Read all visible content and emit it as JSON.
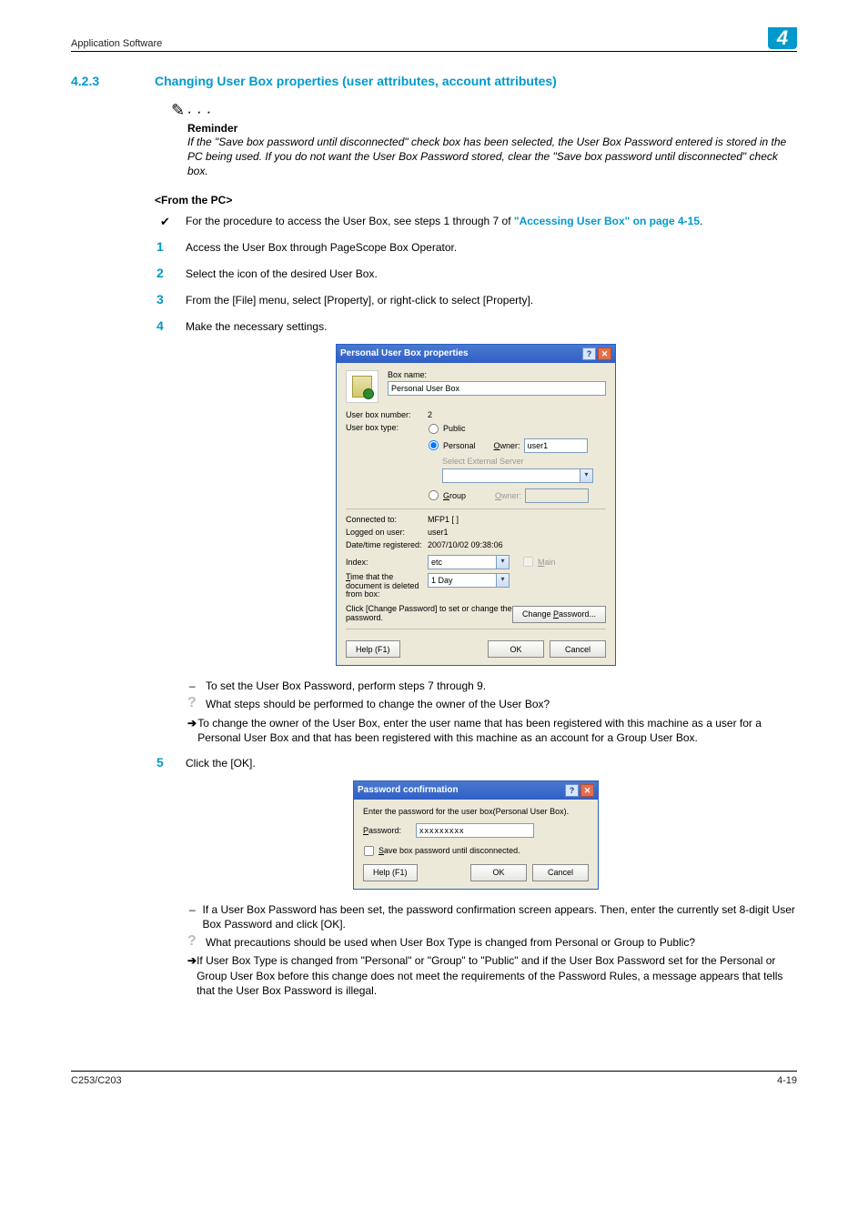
{
  "header": {
    "running_head": "Application Software",
    "chapter_badge": "4"
  },
  "section": {
    "number": "4.2.3",
    "title": "Changing User Box properties (user attributes, account attributes)"
  },
  "reminder": {
    "label": "Reminder",
    "body": "If the \"Save box password until disconnected\" check box has been selected, the User Box Password entered is stored in the PC being used. If you do not want the User Box Password stored, clear the \"Save box password until disconnected\" check box."
  },
  "fromPC": {
    "heading": "<From the PC>",
    "check_prefix": "For the procedure to access the User Box, see steps 1 through 7 of ",
    "check_link": "\"Accessing User Box\" on page 4-15",
    "check_suffix": "."
  },
  "steps": {
    "s1": "Access the User Box through PageScope Box Operator.",
    "s2": "Select the icon of the desired User Box.",
    "s3": "From the [File] menu, select [Property], or right-click to select [Property].",
    "s4": "Make the necessary settings.",
    "s5": "Click the [OK]."
  },
  "dialog1": {
    "title": "Personal User Box properties",
    "boxname_label": "Box name:",
    "boxname_value": "Personal User Box",
    "num_label": "User box number:",
    "num_value": "2",
    "type_label": "User box type:",
    "type_public": "Public",
    "type_personal": "Personal",
    "owner_label": "Owner:",
    "owner_value": "user1",
    "ext_label": "Select External Server",
    "type_group": "Group",
    "group_owner_label": "Owner:",
    "connected_label": "Connected to:",
    "connected_value": "MFP1 [                ]",
    "logged_label": "Logged on user:",
    "logged_value": "user1",
    "datetime_label": "Date/time registered:",
    "datetime_value": "2007/10/02 09:38:06",
    "index_label": "Index:",
    "index_value": "etc",
    "main_label": "Main",
    "retain_label": "Time that the document is deleted from box:",
    "retain_value": "1 Day",
    "changepw_hint": "Click [Change Password] to set or change the password.",
    "changepw_btn": "Change Password...",
    "help_btn": "Help (F1)",
    "ok_btn": "OK",
    "cancel_btn": "Cancel"
  },
  "after_dialog1": {
    "dash1": "To set the User Box Password, perform steps 7 through 9.",
    "q1": "What steps should be performed to change the owner of the User Box?",
    "a1": "To change the owner of the User Box, enter the user name that has been registered with this machine as a user for a Personal User Box and that has been registered with this machine as an account for a Group User Box."
  },
  "dialog2": {
    "title": "Password confirmation",
    "prompt": "Enter the password for the user box(Personal User Box).",
    "password_label": "Password:",
    "password_mask": "xxxxxxxxx",
    "checkbox_label": "Save box password until disconnected.",
    "help_btn": "Help (F1)",
    "ok_btn": "OK",
    "cancel_btn": "Cancel"
  },
  "after_dialog2": {
    "dash1": "If a User Box Password has been set, the password confirmation screen appears. Then, enter the currently set 8-digit User Box Password and click [OK].",
    "q1": "What precautions should be used when User Box Type is changed from Personal or Group to Public?",
    "a1": "If User Box Type is changed from \"Personal\" or \"Group\" to \"Public\" and if the User Box Password set for the Personal or Group User Box before this change does not meet the requirements of the Password Rules, a message appears that tells that the User Box Password is illegal."
  },
  "footer": {
    "left": "C253/C203",
    "right": "4-19"
  }
}
